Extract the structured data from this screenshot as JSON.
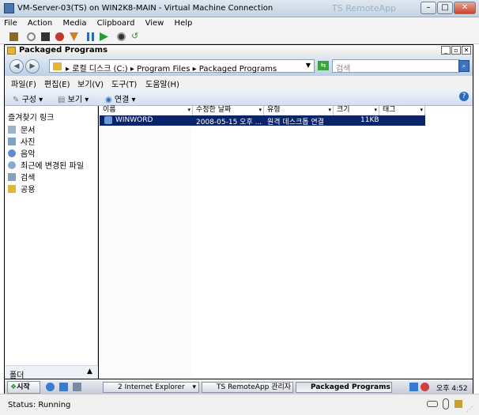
{
  "window": {
    "title": "VM-Server-03(TS) on WIN2K8-MAIN - Virtual Machine Connection",
    "ghost_title": "TS RemoteApp",
    "menu": [
      "File",
      "Action",
      "Media",
      "Clipboard",
      "View",
      "Help"
    ],
    "status": "Status: Running"
  },
  "explorer": {
    "title": "Packaged Programs",
    "address": "▸ 로컬 디스크 (C:) ▸ Program Files ▸ Packaged Programs",
    "search_placeholder": "검색",
    "menu": [
      "파일(F)",
      "편집(E)",
      "보기(V)",
      "도구(T)",
      "도움말(H)"
    ],
    "commands": [
      "구성",
      "보기",
      "연결"
    ],
    "favorites_header": "즐겨찾기 링크",
    "favorites": [
      "문서",
      "사진",
      "음악",
      "최근에 변경된 파일",
      "검색",
      "공용"
    ],
    "folders_label": "폴더",
    "columns": [
      "이름",
      "수정한 날짜",
      "유형",
      "크기",
      "태그"
    ],
    "files": [
      {
        "name": "WINWORD",
        "modified": "2008-05-15 오후 ...",
        "type": "원격 데스크톱 연결",
        "size": "11KB"
      }
    ]
  },
  "taskbar": {
    "start": "시작",
    "tasks": [
      "2 Internet Explorer",
      "TS RemoteApp 관리자",
      "Packaged Programs"
    ],
    "clock": "오후 4:52"
  },
  "colors": {
    "selection": "#0a246a",
    "titlebar": "#dfe8f1"
  }
}
